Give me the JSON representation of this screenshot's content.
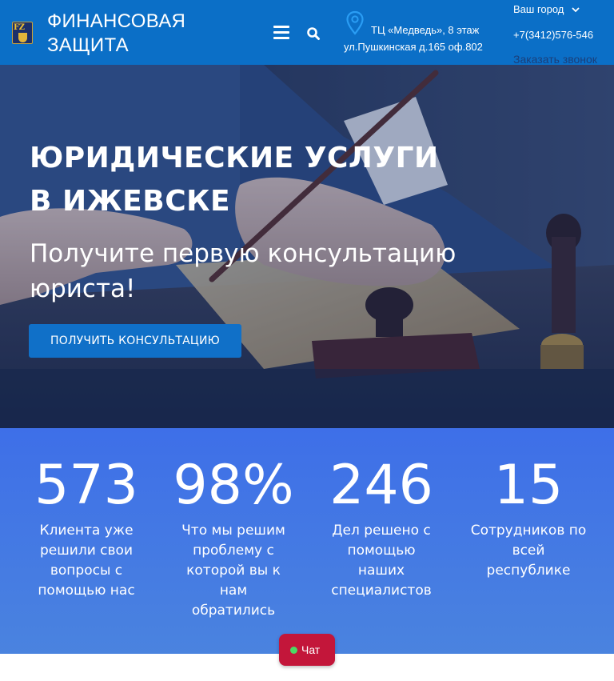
{
  "header": {
    "logo_text": "FZ",
    "brand_line1": "ФИНАНСОВАЯ",
    "brand_line2": "ЗАЩИТА",
    "menu_icon": "hamburger-menu-icon",
    "search_icon": "search-icon",
    "location_icon": "map-pin-icon",
    "address_line1": "ТЦ «Медведь», 8 этаж",
    "address_line2": "ул.Пушкинская д.165 оф.802",
    "city_label": "Ваш город",
    "phone": "+7(3412)576-546",
    "callback_label": "Заказать звонок",
    "bg_color": "#0b6fc7"
  },
  "hero": {
    "title_line1": "ЮРИДИЧЕСКИЕ УСЛУГИ",
    "title_line2": "В ИЖЕВСКЕ",
    "subtitle_line1": "Получите первую консультацию",
    "subtitle_line2": "юриста!",
    "cta_label": "ПОЛУЧИТЬ КОНСУЛЬТАЦИЮ",
    "cta_color": "#1070c8"
  },
  "stats": [
    {
      "number": "573",
      "label_lines": [
        "Клиента уже",
        "решили свои",
        "вопросы с",
        "помощью нас"
      ]
    },
    {
      "number": "98%",
      "label_lines": [
        "Что мы решим",
        "проблему с",
        "которой вы к",
        "нам",
        "обратились"
      ]
    },
    {
      "number": "246",
      "label_lines": [
        "Дел решено с",
        "помощью",
        "наших",
        "специалистов"
      ]
    },
    {
      "number": "15",
      "label_lines": [
        "Сотрудников по",
        "всей",
        "республике"
      ]
    }
  ],
  "chat": {
    "label": "Чат",
    "color": "#c3163a",
    "status_color": "#4cd964"
  }
}
